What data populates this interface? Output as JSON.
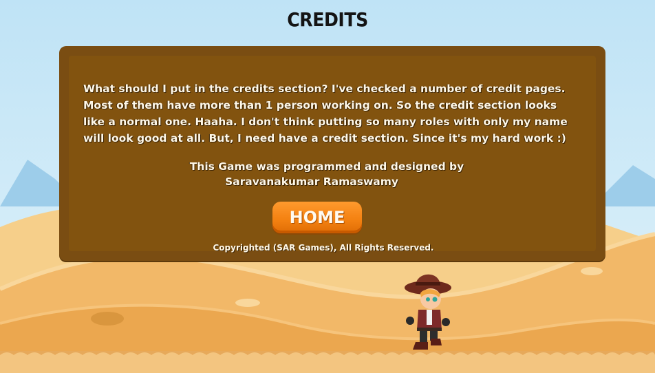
{
  "screen": {
    "title": "CREDITS"
  },
  "panel": {
    "intro_lines": [
      "What should I put in the credits section? I've checked a number of credit pages.",
      "Most of them have more than 1 person working on. So the credit section looks",
      "like a normal one. Haaha. I don't think putting  so many roles with only my name",
      "will look good at all. But, I need have a credit section. Since it's my hard work :)"
    ],
    "credit_line_1": "This Game was programmed and designed by",
    "credit_line_2": "Saravanakumar Ramaswamy",
    "home_button": "HOME",
    "copyright": "Copyrighted (SAR Games), All Rights Reserved."
  },
  "colors": {
    "sky": "#bfe3f6",
    "sand": "#f0b35a",
    "panel_brown": "#82530f",
    "button_orange": "#f48212"
  }
}
